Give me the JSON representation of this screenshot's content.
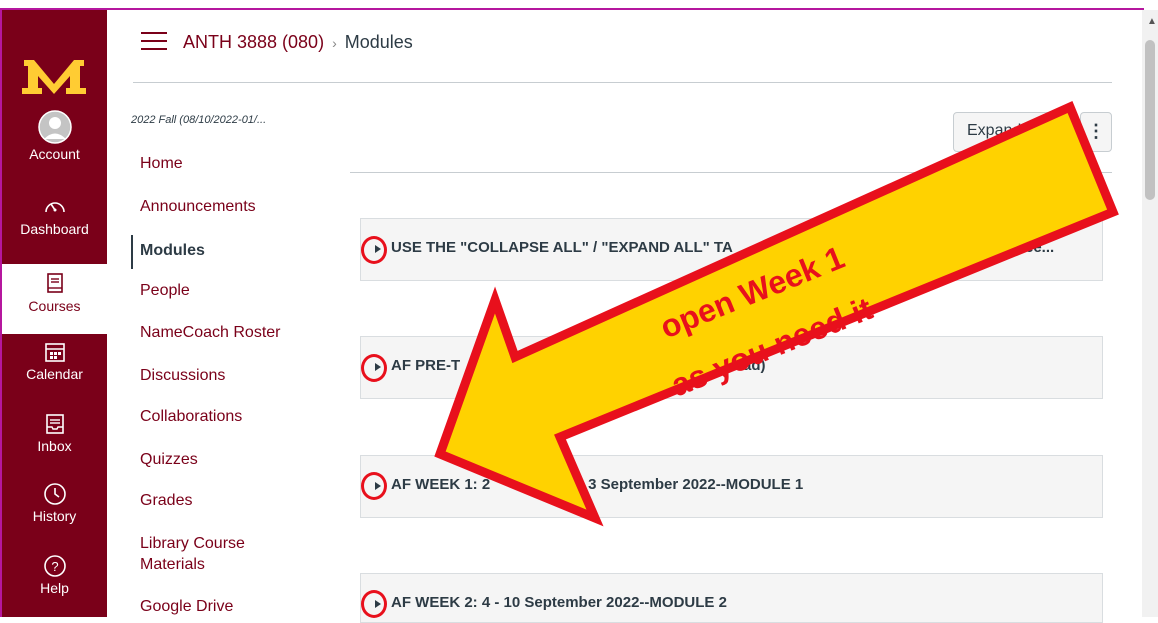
{
  "colors": {
    "brand": "#7a0019",
    "gold": "#ffcc33",
    "annotation_red": "#e8101c",
    "annotation_yellow": "#ffd200",
    "window_border": "#b5179e"
  },
  "global_nav": {
    "items": [
      {
        "label": "Account",
        "icon": "account-avatar-icon"
      },
      {
        "label": "Dashboard",
        "icon": "dashboard-gauge-icon"
      },
      {
        "label": "Courses",
        "icon": "courses-book-icon",
        "active": true
      },
      {
        "label": "Calendar",
        "icon": "calendar-icon"
      },
      {
        "label": "Inbox",
        "icon": "inbox-icon"
      },
      {
        "label": "History",
        "icon": "history-clock-icon"
      },
      {
        "label": "Help",
        "icon": "help-question-icon"
      }
    ]
  },
  "header": {
    "course": "ANTH 3888 (080)",
    "separator": "›",
    "current": "Modules"
  },
  "course_nav": {
    "term": "2022 Fall (08/10/2022-01/...",
    "items": [
      {
        "label": "Home"
      },
      {
        "label": "Announcements"
      },
      {
        "label": "Modules",
        "active": true
      },
      {
        "label": "People"
      },
      {
        "label": "NameCoach Roster"
      },
      {
        "label": "Discussions"
      },
      {
        "label": "Collaborations"
      },
      {
        "label": "Quizzes"
      },
      {
        "label": "Grades"
      },
      {
        "label": "Library Course\nMaterials"
      },
      {
        "label": "Google Drive"
      }
    ]
  },
  "toolbar": {
    "expand_label": "Expand",
    "more_label": "⋮"
  },
  "modules": [
    {
      "title": "USE THE \"COLLAPSE ALL\" / \"EXPAND ALL\" TA",
      "title_tail": "ee..."
    },
    {
      "title": "AF PRE-T",
      "title_tail": "E, but read)"
    },
    {
      "title": "AF WEEK 1: 2",
      "title_tail": "- 3 September 2022--MODULE 1"
    },
    {
      "title": "AF WEEK 2: 4 - 10 September 2022--MODULE 2",
      "title_tail": ""
    }
  ],
  "annotation": {
    "line1": "open Week 1",
    "line2": "as you need it"
  }
}
